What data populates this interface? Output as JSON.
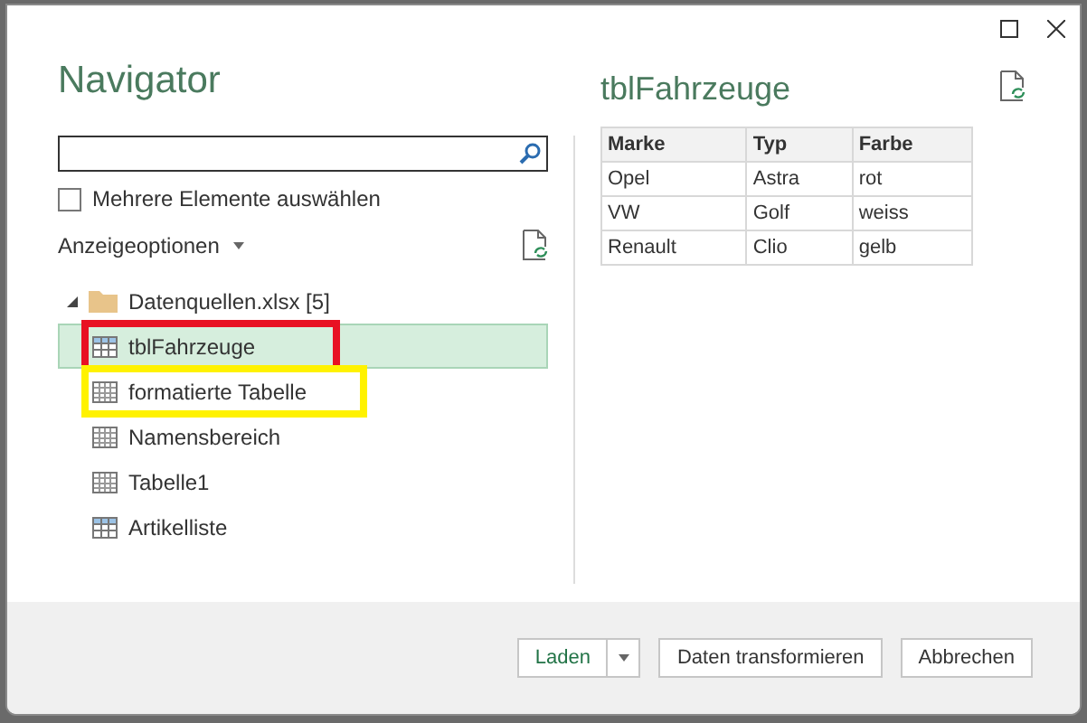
{
  "window": {
    "title": "Navigator"
  },
  "multi_select": {
    "label": "Mehrere Elemente auswählen",
    "checked": false
  },
  "display_options": {
    "label": "Anzeigeoptionen"
  },
  "tree": [
    {
      "label": "Datenquellen.xlsx [5]",
      "kind": "folder",
      "expanded": true,
      "selected": false,
      "children": [
        {
          "label": "tblFahrzeuge",
          "kind": "table",
          "selected": true,
          "color": "#e81123"
        },
        {
          "label": "formatierte Tabelle",
          "kind": "sheet",
          "selected": false,
          "color": "#fff200"
        },
        {
          "label": "Namensbereich",
          "kind": "sheet",
          "selected": false
        },
        {
          "label": "Tabelle1",
          "kind": "sheet",
          "selected": false
        },
        {
          "label": "Artikelliste",
          "kind": "table",
          "selected": false
        }
      ]
    }
  ],
  "preview": {
    "title": "tblFahrzeuge",
    "columns": [
      "Marke",
      "Typ",
      "Farbe"
    ],
    "rows": [
      [
        "Opel",
        "Astra",
        "rot"
      ],
      [
        "VW",
        "Golf",
        "weiss"
      ],
      [
        "Renault",
        "Clio",
        "gelb"
      ]
    ]
  },
  "buttons": [
    {
      "label": "Laden",
      "kind": "split"
    },
    {
      "label": "Daten transformieren",
      "kind": "plain"
    },
    {
      "label": "Abbrechen",
      "kind": "plain"
    }
  ]
}
